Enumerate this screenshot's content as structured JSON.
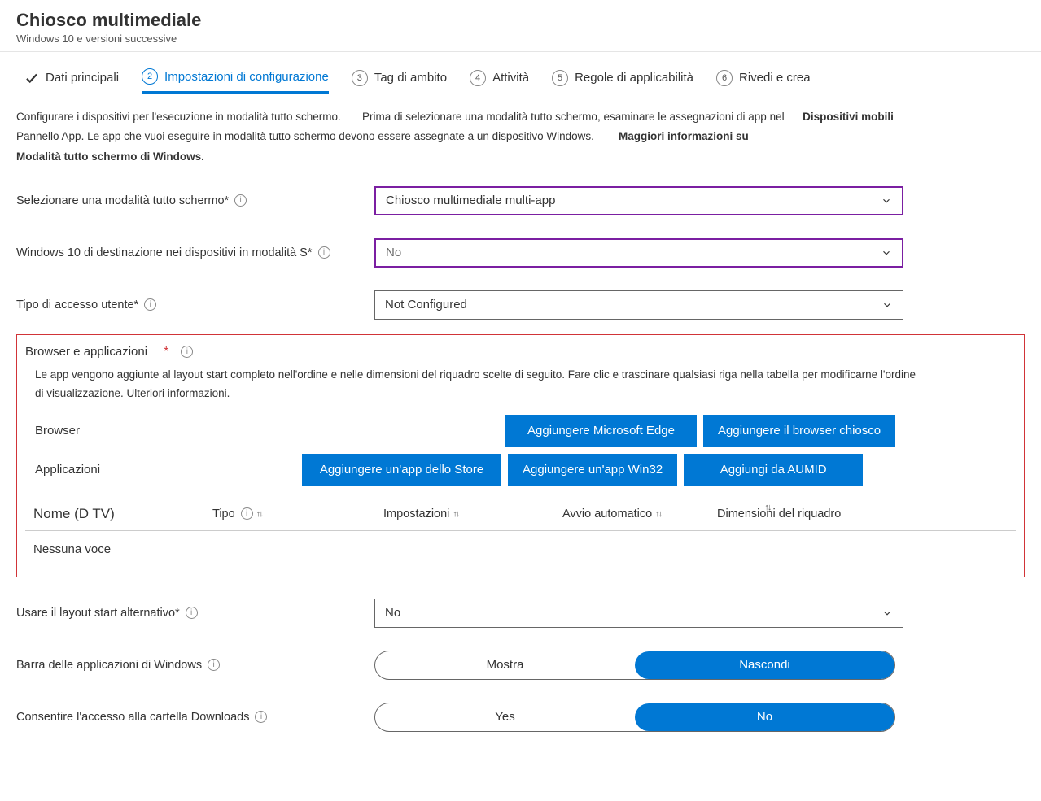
{
  "header": {
    "title": "Chiosco multimediale",
    "subtitle": "Windows 10 e versioni successive"
  },
  "tabs": {
    "t1": "Dati principali",
    "t2": "Impostazioni di configurazione",
    "t3": "Tag di ambito",
    "t4": "Attività",
    "t5": "Regole di applicabilità",
    "t6": "Rivedi e crea",
    "step2": "2",
    "step3": "3",
    "step4": "4",
    "step5": "5",
    "step6": "6"
  },
  "intro": {
    "line1a": "Configurare i dispositivi per l'esecuzione in modalità tutto schermo.",
    "line1b": "Prima di selezionare una modalità tutto schermo, esaminare le assegnazioni di app nel",
    "mobile": "Dispositivi mobili",
    "line2a": "Pannello App. Le app che vuoi eseguire in modalità tutto schermo devono essere assegnate a un dispositivo Windows.",
    "more": "Maggiori informazioni su",
    "line3": "Modalità tutto schermo di Windows."
  },
  "form": {
    "kioskMode": {
      "label": "Selezionare una modalità tutto schermo*",
      "value": "Chiosco multimediale multi-app"
    },
    "win10s": {
      "label": "Windows 10 di destinazione nei dispositivi in modalità S*",
      "value": "No"
    },
    "logon": {
      "label": "Tipo di accesso utente*",
      "value": "Not Configured"
    },
    "altLayout": {
      "label": "Usare il layout start alternativo*",
      "value": "No"
    },
    "taskbar": {
      "label": "Barra delle applicazioni di Windows",
      "opt1": "Mostra",
      "opt2": "Nascondi"
    },
    "downloads": {
      "label": "Consentire l'accesso alla cartella Downloads",
      "opt1": "Yes",
      "opt2": "No"
    }
  },
  "apps": {
    "title": "Browser e applicazioni",
    "desc1": "Le app vengono aggiunte al layout start completo nell'ordine e nelle dimensioni del riquadro scelte di seguito. Fare clic e trascinare qualsiasi riga nella tabella per modificarne l'ordine",
    "desc2": "di visualizzazione. Ulteriori informazioni.",
    "row1label": "Browser",
    "row2label": "Applicazioni",
    "btnEdge": "Aggiungere Microsoft Edge",
    "btnKioskBrowser": "Aggiungere il browser chiosco",
    "btnStore": "Aggiungere un'app dello Store",
    "btnWin32": "Aggiungere un'app Win32",
    "btnAumid": "Aggiungi da AUMID",
    "thName": "Nome (D TV)",
    "thType": "Tipo",
    "thSettings": "Impostazioni",
    "thAuto": "Avvio automatico",
    "thTile": "Dimensioni del riquadro",
    "empty": "Nessuna voce"
  }
}
